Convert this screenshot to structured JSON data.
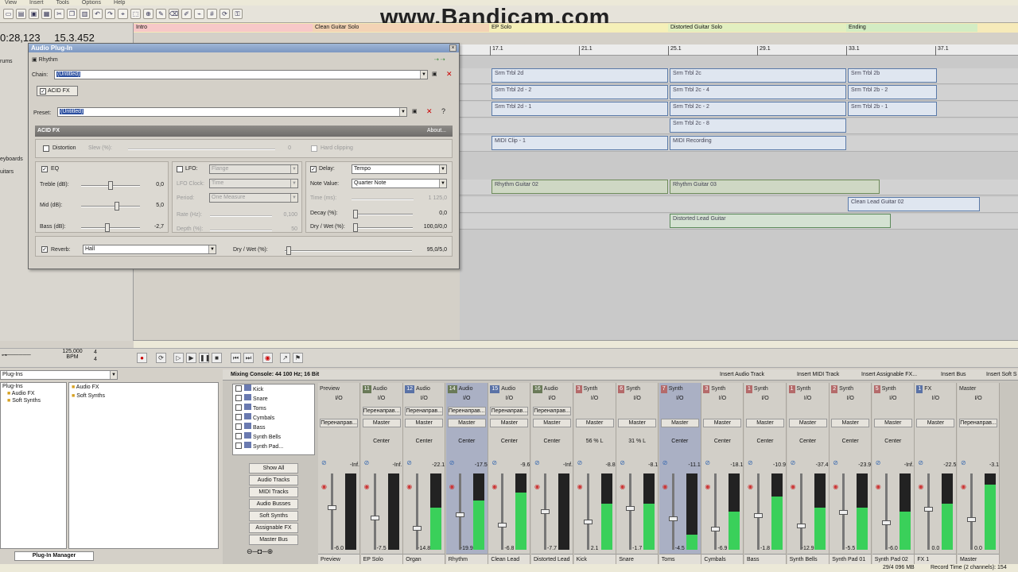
{
  "menu": [
    "View",
    "Insert",
    "Tools",
    "Options",
    "Help"
  ],
  "watermark": "www.Bandicam.com",
  "time_display": "0:28,123",
  "time_display2": "15.3.452",
  "left_labels": [
    "rums",
    "eyboards",
    "uitars"
  ],
  "markers": [
    {
      "label": "Intro",
      "color": "#f7c8c8"
    },
    {
      "label": "Clean Guitar Solo",
      "color": "#f3d3b5"
    },
    {
      "label": "EP Solo",
      "color": "#f5f0b8"
    },
    {
      "label": "Distorted Guitar Solo",
      "color": "#e2efc0"
    },
    {
      "label": "Ending",
      "color": "#d3ecc3"
    }
  ],
  "ruler": [
    "17.1",
    "21.1",
    "25.1",
    "29.1",
    "33.1",
    "37.1"
  ],
  "clips": {
    "row1": [
      "Srm Trbl 2d",
      "Srm Trbl 2c",
      "Srm Trbl 2b"
    ],
    "row2": [
      "Srm Trbl 2d - 2",
      "Srm Trbl 2c - 4",
      "Srm Trbl 2b - 2"
    ],
    "row3": [
      "Srm Trbl 2d - 1",
      "Srm Trbl 2c - 2",
      "Srm Trbl 2b - 1"
    ],
    "row4": [
      "Srm Trbl 2c - 8"
    ],
    "midi1": "MIDI Clip - 1",
    "midi2": "MIDI Recording",
    "rhythm1": "Rhythm Guitar 02",
    "rhythm2": "Rhythm Guitar 03",
    "clean": "Clean Lead Guitar 02",
    "distorted": "Distorted Lead Guitar"
  },
  "tempo": "125,000",
  "tempo_unit": "BPM",
  "time_sig": "4",
  "plugin": {
    "title": "Audio Plug-In",
    "subtitle": "Rhythm",
    "chain_label": "Chain:",
    "chain_value": "(Untitled)",
    "fx_tab": "ACID FX",
    "preset_label": "Preset:",
    "preset_value": "(Untitled)",
    "acid_fx": "ACID FX",
    "about": "About...",
    "distortion": "Distortion",
    "slew": "Slew (%):",
    "slew_val": "0",
    "hard_clipping": "Hard clipping",
    "eq": "EQ",
    "treble": "Treble (dB):",
    "treble_val": "0,0",
    "mid": "Mid (dB):",
    "mid_val": "5,0",
    "bass": "Bass (dB):",
    "bass_val": "-2,7",
    "lfo": "LFO:",
    "lfo_val": "Flange",
    "lfo_clock": "LFO Clock:",
    "lfo_clock_val": "Time",
    "period": "Period:",
    "period_val": "One Measure",
    "rate": "Rate (Hz):",
    "rate_val": "0,100",
    "depth": "Depth (%):",
    "depth_val": "50",
    "delay": "Delay:",
    "delay_val": "Tempo",
    "note_value": "Note Value:",
    "note_value_val": "Quarter Note",
    "time_ms": "Time (ms):",
    "time_ms_val": "1 125,0",
    "decay": "Decay (%):",
    "decay_val": "0,0",
    "drywet": "Dry / Wet (%):",
    "drywet_val": "100,0/0,0",
    "reverb": "Reverb:",
    "reverb_val": "Hall",
    "rev_drywet": "Dry / Wet (%):",
    "rev_drywet_val": "95,0/5,0"
  },
  "plugins_panel": {
    "dropdown": "Plug-Ins",
    "tree": [
      "Plug-Ins",
      "Audio FX",
      "Soft Synths"
    ],
    "folders": [
      "Audio FX",
      "Soft Synths"
    ],
    "tabs": [
      "Plug-In Manager"
    ]
  },
  "mixer": {
    "title": "Mixing Console: 44 100 Hz; 16 Bit",
    "header_buttons": [
      "Insert Audio Track",
      "Insert MIDI Track",
      "Insert Assignable FX...",
      "Insert Bus",
      "Insert Soft S"
    ],
    "track_list": [
      "Kick",
      "Snare",
      "Toms",
      "Cymbals",
      "Bass",
      "Synth Bells",
      "Synth Pad..."
    ],
    "view_buttons": [
      "Show All",
      "Audio Tracks",
      "MIDI Tracks",
      "Audio Busses",
      "Soft Synths",
      "Assignable FX",
      "Master Bus"
    ],
    "strips": [
      {
        "num": "",
        "type": "Preview",
        "io": "I/O",
        "send": "",
        "out": "Перенаправ...",
        "pan": "",
        "peak": "-Inf.",
        "level": 0,
        "foot": "Preview",
        "val": "-6.0",
        "sel": false,
        "kind": ""
      },
      {
        "num": "11",
        "type": "Audio",
        "io": "I/O",
        "send": "Перенаправ...",
        "out": "Master",
        "pan": "Center",
        "peak": "-Inf.",
        "level": 0,
        "foot": "EP Solo",
        "val": "-7.5",
        "sel": false,
        "kind": "g"
      },
      {
        "num": "12",
        "type": "Audio",
        "io": "I/O",
        "send": "Перенаправ...",
        "out": "Master",
        "pan": "Center",
        "peak": "-22.1",
        "level": 0.55,
        "foot": "Organ",
        "val": "-14.8",
        "sel": false,
        "kind": "a"
      },
      {
        "num": "14",
        "type": "Audio",
        "io": "I/O",
        "send": "Перенаправ...",
        "out": "Master",
        "pan": "Center",
        "peak": "-17.5",
        "level": 0.65,
        "foot": "Rhythm",
        "val": "-19.9",
        "sel": true,
        "kind": "g"
      },
      {
        "num": "15",
        "type": "Audio",
        "io": "I/O",
        "send": "Перенаправ...",
        "out": "Master",
        "pan": "Center",
        "peak": "-9.6",
        "level": 0.75,
        "foot": "Clean Lead",
        "val": "-6.8",
        "sel": false,
        "kind": "a"
      },
      {
        "num": "16",
        "type": "Audio",
        "io": "I/O",
        "send": "Перенаправ...",
        "out": "Master",
        "pan": "Center",
        "peak": "-Inf.",
        "level": 0,
        "foot": "Distorted Lead",
        "val": "-7.7",
        "sel": false,
        "kind": "g"
      },
      {
        "num": "3",
        "type": "Synth",
        "io": "I/O",
        "send": "",
        "out": "Master",
        "pan": "56 % L",
        "peak": "-8.8",
        "level": 0.6,
        "foot": "Kick",
        "val": "2.1",
        "sel": false,
        "kind": "s"
      },
      {
        "num": "6",
        "type": "Synth",
        "io": "I/O",
        "send": "",
        "out": "Master",
        "pan": "31 % L",
        "peak": "-8.1",
        "level": 0.6,
        "foot": "Snare",
        "val": "-1.7",
        "sel": false,
        "kind": "s"
      },
      {
        "num": "7",
        "type": "Synth",
        "io": "I/O",
        "send": "",
        "out": "Master",
        "pan": "Center",
        "peak": "-11.1",
        "level": 0.2,
        "foot": "Toms",
        "val": "-4.5",
        "sel": true,
        "kind": "s"
      },
      {
        "num": "3",
        "type": "Synth",
        "io": "I/O",
        "send": "",
        "out": "Master",
        "pan": "Center",
        "peak": "-18.1",
        "level": 0.5,
        "foot": "Cymbals",
        "val": "-6.9",
        "sel": false,
        "kind": "s"
      },
      {
        "num": "1",
        "type": "Synth",
        "io": "I/O",
        "send": "",
        "out": "Master",
        "pan": "Center",
        "peak": "-10.9",
        "level": 0.7,
        "foot": "Bass",
        "val": "-1.8",
        "sel": false,
        "kind": "s"
      },
      {
        "num": "1",
        "type": "Synth",
        "io": "I/O",
        "send": "",
        "out": "Master",
        "pan": "Center",
        "peak": "-37.4",
        "level": 0.55,
        "foot": "Synth Bells",
        "val": "-12.9",
        "sel": false,
        "kind": "s"
      },
      {
        "num": "2",
        "type": "Synth",
        "io": "I/O",
        "send": "",
        "out": "Master",
        "pan": "Center",
        "peak": "-23.9",
        "level": 0.55,
        "foot": "Synth Pad 01",
        "val": "-5.5",
        "sel": false,
        "kind": "s"
      },
      {
        "num": "5",
        "type": "Synth",
        "io": "I/O",
        "send": "",
        "out": "Master",
        "pan": "Center",
        "peak": "-Inf.",
        "level": 0.5,
        "foot": "Synth Pad 02",
        "val": "-6.0",
        "sel": false,
        "kind": "s"
      },
      {
        "num": "1",
        "type": "FX",
        "io": "I/O",
        "send": "",
        "out": "Master",
        "pan": "",
        "peak": "-22.5",
        "level": 0.6,
        "foot": "FX 1",
        "val": "0.0",
        "sel": false,
        "kind": "a"
      },
      {
        "num": "",
        "type": "Master",
        "io": "I/O",
        "send": "",
        "out": "Перенаправ...",
        "pan": "",
        "peak": "-3.1",
        "level": 0.85,
        "foot": "Master",
        "val": "0.0",
        "sel": false,
        "kind": ""
      }
    ]
  },
  "status": {
    "disk": "29/4 096 MB",
    "record_time": "Record Time (2 channels): 154"
  }
}
